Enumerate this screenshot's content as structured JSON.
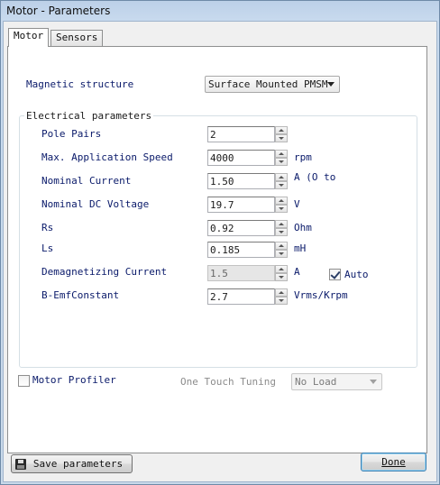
{
  "window": {
    "title": "Motor - Parameters"
  },
  "tabs": [
    {
      "label": "Motor",
      "active": true
    },
    {
      "label": "Sensors",
      "active": false
    }
  ],
  "magnetic": {
    "label": "Magnetic structure",
    "value": "Surface Mounted PMSM"
  },
  "electrical": {
    "title": "Electrical parameters",
    "rows": [
      {
        "label": "Pole Pairs",
        "value": "2",
        "unit": "",
        "enabled": true
      },
      {
        "label": "Max. Application Speed",
        "value": "4000",
        "unit": "rpm",
        "enabled": true
      },
      {
        "label": "Nominal Current",
        "value": "1.50",
        "unit": "A (O to",
        "enabled": true
      },
      {
        "label": "Nominal DC Voltage",
        "value": "19.7",
        "unit": "V",
        "enabled": true
      },
      {
        "label": "Rs",
        "value": "0.92",
        "unit": "Ohm",
        "enabled": true
      },
      {
        "label": "Ls",
        "value": "0.185",
        "unit": "mH",
        "enabled": true
      },
      {
        "label": "Demagnetizing Current",
        "value": "1.5",
        "unit": "A",
        "enabled": false
      },
      {
        "label": "B-EmfConstant",
        "value": "2.7",
        "unit": "Vrms/Krpm",
        "enabled": true
      }
    ],
    "auto": {
      "label": "Auto",
      "checked": true
    }
  },
  "profiler": {
    "label": "Motor Profiler",
    "checked": false,
    "one_touch_label": "One Touch Tuning",
    "load_value": "No Load"
  },
  "footer": {
    "save_label": "Save parameters",
    "done_label": "Done"
  },
  "icons": {
    "save": "floppy-disk-icon",
    "spin_up": "arrow-up-icon",
    "spin_down": "arrow-down-icon",
    "dropdown": "chevron-down-icon"
  }
}
